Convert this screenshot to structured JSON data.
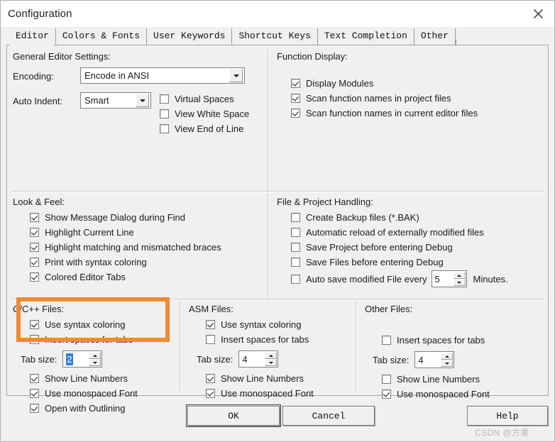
{
  "window": {
    "title": "Configuration",
    "close_icon": "close-icon"
  },
  "tabs": [
    {
      "label": "Editor",
      "selected": true
    },
    {
      "label": "Colors & Fonts",
      "selected": false
    },
    {
      "label": "User Keywords",
      "selected": false
    },
    {
      "label": "Shortcut Keys",
      "selected": false
    },
    {
      "label": "Text Completion",
      "selected": false
    },
    {
      "label": "Other",
      "selected": false
    }
  ],
  "general": {
    "title": "General Editor Settings:",
    "encoding_label": "Encoding:",
    "encoding_value": "Encode in ANSI",
    "auto_indent_label": "Auto Indent:",
    "auto_indent_value": "Smart",
    "checks": [
      {
        "label": "Virtual Spaces",
        "checked": false
      },
      {
        "label": "View White Space",
        "checked": false
      },
      {
        "label": "View End of Line",
        "checked": false
      }
    ]
  },
  "function_display": {
    "title": "Function Display:",
    "checks": [
      {
        "label": "Display Modules",
        "checked": true
      },
      {
        "label": "Scan function names in project files",
        "checked": true
      },
      {
        "label": "Scan function names in current editor files",
        "checked": true
      }
    ]
  },
  "look_feel": {
    "title": "Look & Feel:",
    "checks": [
      {
        "label": "Show Message Dialog during Find",
        "checked": true
      },
      {
        "label": "Highlight Current Line",
        "checked": true
      },
      {
        "label": "Highlight matching and mismatched braces",
        "checked": true
      },
      {
        "label": "Print with syntax coloring",
        "checked": true
      },
      {
        "label": "Colored Editor Tabs",
        "checked": true
      }
    ]
  },
  "file_project": {
    "title": "File & Project Handling:",
    "checks": [
      {
        "label": "Create Backup files (*.BAK)",
        "checked": false
      },
      {
        "label": "Automatic reload of externally modified files",
        "checked": false
      },
      {
        "label": "Save Project before entering Debug",
        "checked": false
      },
      {
        "label": "Save Files before entering Debug",
        "checked": false
      }
    ],
    "autosave_label": "Auto save modified File every",
    "autosave_checked": false,
    "autosave_value": "5",
    "autosave_suffix": "Minutes."
  },
  "cpp_files": {
    "title": "C/C++ Files:",
    "use_syntax": {
      "label": "Use syntax coloring",
      "checked": true
    },
    "insert_spaces": {
      "label": "Insert spaces for tabs",
      "checked": true
    },
    "tab_size_label": "Tab size:",
    "tab_size_value": "2",
    "tab_size_selected": true,
    "show_line_numbers": {
      "label": "Show Line Numbers",
      "checked": true
    },
    "monospaced": {
      "label": "Use monospaced Font",
      "checked": true
    },
    "outlining": {
      "label": "Open with Outlining",
      "checked": true
    }
  },
  "asm_files": {
    "title": "ASM Files:",
    "use_syntax": {
      "label": "Use syntax coloring",
      "checked": true
    },
    "insert_spaces": {
      "label": "Insert spaces for tabs",
      "checked": false
    },
    "tab_size_label": "Tab size:",
    "tab_size_value": "4",
    "show_line_numbers": {
      "label": "Show Line Numbers",
      "checked": true
    },
    "monospaced": {
      "label": "Use monospaced Font",
      "checked": true
    }
  },
  "other_files": {
    "title": "Other Files:",
    "insert_spaces": {
      "label": "Insert spaces for tabs",
      "checked": false
    },
    "tab_size_label": "Tab size:",
    "tab_size_value": "4",
    "show_line_numbers": {
      "label": "Show Line Numbers",
      "checked": false
    },
    "monospaced": {
      "label": "Use monospaced Font",
      "checked": true
    }
  },
  "buttons": {
    "ok": "OK",
    "cancel": "Cancel",
    "help": "Help"
  },
  "watermark": "CSDN @方栗",
  "colors": {
    "highlight_border": "#f08a33",
    "dialog_background": "#f0f0f0",
    "selection_blue": "#2f7fe0"
  }
}
